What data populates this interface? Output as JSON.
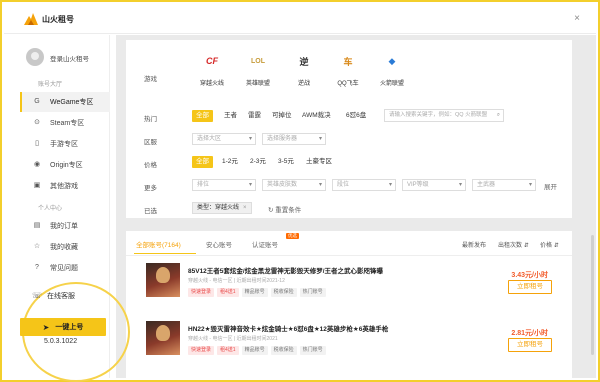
{
  "app": {
    "title": "山火租号"
  },
  "window": {
    "close": "×"
  },
  "sidebar": {
    "login": "登录山火租号",
    "section_account": "账号大厅",
    "section_personal": "个人中心",
    "items": [
      {
        "label": "WeGame专区",
        "icon": "G"
      },
      {
        "label": "Steam专区",
        "icon": "⊙"
      },
      {
        "label": "手游专区",
        "icon": "▯"
      },
      {
        "label": "Origin专区",
        "icon": "◉"
      },
      {
        "label": "其他游戏",
        "icon": "▣"
      },
      {
        "label": "我的订单",
        "icon": "▤"
      },
      {
        "label": "我的收藏",
        "icon": "☆"
      },
      {
        "label": "常见问题",
        "icon": "?"
      }
    ],
    "service": "在线客服",
    "onekey": "一键上号",
    "version": "5.0.3.1022"
  },
  "filters": {
    "labels": {
      "game": "游戏",
      "hot": "热门",
      "region": "区服",
      "price": "价格",
      "more": "更多",
      "selected": "已选"
    },
    "games": [
      {
        "name": "穿越火线",
        "logo": "CF"
      },
      {
        "name": "英雄联盟",
        "logo": "LOL"
      },
      {
        "name": "逆战",
        "logo": "逆"
      },
      {
        "name": "QQ飞车",
        "logo": "车"
      },
      {
        "name": "火箭联盟",
        "logo": "◆"
      }
    ],
    "hot_tags": [
      "全部",
      "王者",
      "雷霆",
      "可掉位",
      "AWM裁决",
      "6怼6盘"
    ],
    "search_placeholder": "请输入搜索关键字，例如：QQ 火箭联盟",
    "region_selects": [
      "选择大区",
      "选择服务器"
    ],
    "price_tags": [
      "全部",
      "1-2元",
      "2-3元",
      "3-5元",
      "土豪专区"
    ],
    "more_selects": [
      "排位",
      "英雄皮肤数",
      "段位",
      "VIP等级",
      "主武器"
    ],
    "more_expand": "展开",
    "selected_chip": "类型：穿越火线",
    "reset": "重置条件"
  },
  "list": {
    "tabs": [
      "全部账号(7164)",
      "安心账号",
      "认证账号"
    ],
    "tab_badge": "优选",
    "sort": [
      "最新发布",
      "出租次数",
      "价格"
    ],
    "items": [
      {
        "title": "85V12王者5套炫金/炫金黑龙雷神无影毁天修罗/王者之武心影咫锋曝",
        "meta": "穿越火线 - 电信一区  |  近期出租时间2021-12",
        "tags": [
          "快速登录",
          "租4送1",
          "精品账号",
          "税收保险",
          "热门账号"
        ],
        "price": "3.43元/小时",
        "button": "立即租号"
      },
      {
        "title": "HN22★毁灭雷神音效卡★炫金骑士★6怼6盘★12英雄步枪★6英雄手枪",
        "meta": "穿越火线 - 电信一区  |  近期出租时间2021",
        "tags": [
          "快速登录",
          "租4送1",
          "精品账号",
          "税收保险",
          "热门账号"
        ],
        "price": "2.81元/小时",
        "button": "立即租号"
      }
    ]
  }
}
